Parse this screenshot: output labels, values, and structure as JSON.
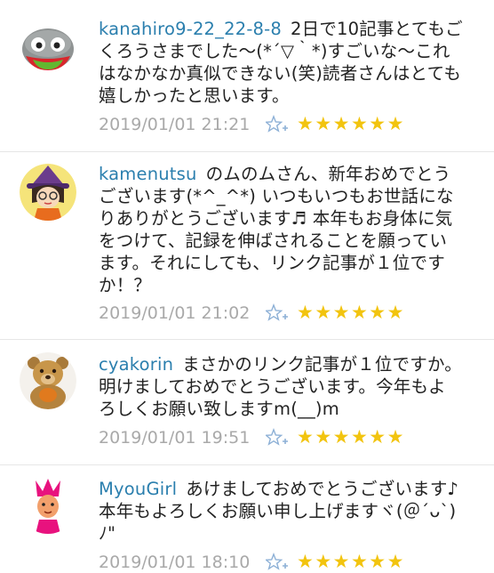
{
  "comments": [
    {
      "username": "kanahiro9-22_22-8-8",
      "text": "2日で10記事とてもごくろうさまでした～(*´▽｀*)すごいな～これはなかなか真似できない(笑)読者さんはとても嬉しかったと思います。",
      "time": "2019/01/01 21:21",
      "stars": "★★★★★★",
      "avatar": "grey-blob-character"
    },
    {
      "username": "kamenutsu",
      "text": "のムのムさん、新年おめでとうございます(*^_^*) いつもいつもお世話になりありがとうございます♬ 本年もお身体に気をつけて、記録を伸ばされることを願っています。それにしても、リンク記事が１位ですか！？",
      "time": "2019/01/01 21:02",
      "stars": "★★★★★★",
      "avatar": "witch-character"
    },
    {
      "username": "cyakorin",
      "text": "まさかのリンク記事が１位ですか。明けましておめでとうございます。今年もよろしくお願い致しますm(__)m",
      "time": "2019/01/01 19:51",
      "stars": "★★★★★★",
      "avatar": "teddy-bear"
    },
    {
      "username": "MyouGirl",
      "text": "あけましておめでとうございます♪　本年もよろしくお願い申し上げますヾ(＠ˊᴗˋ)ﾉ\"",
      "time": "2019/01/01 18:10",
      "stars": "★★★★★★",
      "avatar": "pink-hair-character"
    }
  ],
  "colors": {
    "username": "#2b7fae",
    "timestamp": "#a9a9a9",
    "star": "#f2c40f",
    "star_add_icon": "#8db0d6"
  }
}
